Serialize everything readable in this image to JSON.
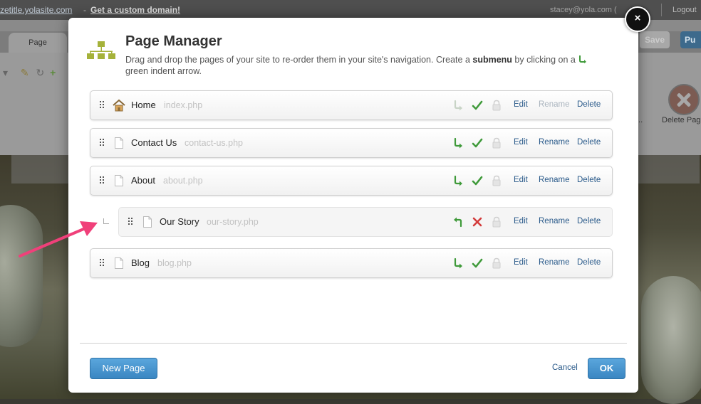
{
  "topbar": {
    "site": "zetitle.yolasite.com",
    "separator": "-",
    "custom_domain": "Get a custom domain!",
    "email": "stacey@yola.com (",
    "logout": "Logout"
  },
  "editor": {
    "tab_label": "Page",
    "save_label": "Save",
    "publish_label": "Pu",
    "delete_page_label": "Delete Pag",
    "ellipsis": "..."
  },
  "modal": {
    "title": "Page Manager",
    "desc_part1": "Drag and drop the pages of your site to re-order them in your site's navigation. Create a ",
    "desc_bold": "submenu",
    "desc_part2": " by clicking on a ",
    "desc_part3": " green indent arrow.",
    "close_label": "×",
    "pages": [
      {
        "name": "Home",
        "file": "index.php",
        "icon": "home-icon",
        "indent_icon": "indent-arrow-icon",
        "status_icon": "checkmark-icon",
        "edit": "Edit",
        "rename": "Rename",
        "delete": "Delete",
        "child": false
      },
      {
        "name": "Contact Us",
        "file": "contact-us.php",
        "icon": "page-icon",
        "indent_icon": "indent-arrow-icon",
        "status_icon": "checkmark-icon",
        "edit": "Edit",
        "rename": "Rename",
        "delete": "Delete",
        "child": false
      },
      {
        "name": "About",
        "file": "about.php",
        "icon": "page-icon",
        "indent_icon": "indent-arrow-icon",
        "status_icon": "checkmark-icon",
        "edit": "Edit",
        "rename": "Rename",
        "delete": "Delete",
        "child": false
      },
      {
        "name": "Our Story",
        "file": "our-story.php",
        "icon": "page-icon",
        "indent_icon": "outdent-arrow-icon",
        "status_icon": "x-mark-icon",
        "edit": "Edit",
        "rename": "Rename",
        "delete": "Delete",
        "child": true
      },
      {
        "name": "Blog",
        "file": "blog.php",
        "icon": "page-icon",
        "indent_icon": "indent-arrow-icon",
        "status_icon": "checkmark-icon",
        "edit": "Edit",
        "rename": "Rename",
        "delete": "Delete",
        "child": false
      }
    ],
    "new_page_label": "New Page",
    "cancel_label": "Cancel",
    "ok_label": "OK"
  },
  "colors": {
    "link": "#2a5a8a",
    "primary_button": "#3a86c2",
    "green_check": "#3f9a3a",
    "red_x": "#d33b3b",
    "annotation_arrow": "#f0407a"
  }
}
